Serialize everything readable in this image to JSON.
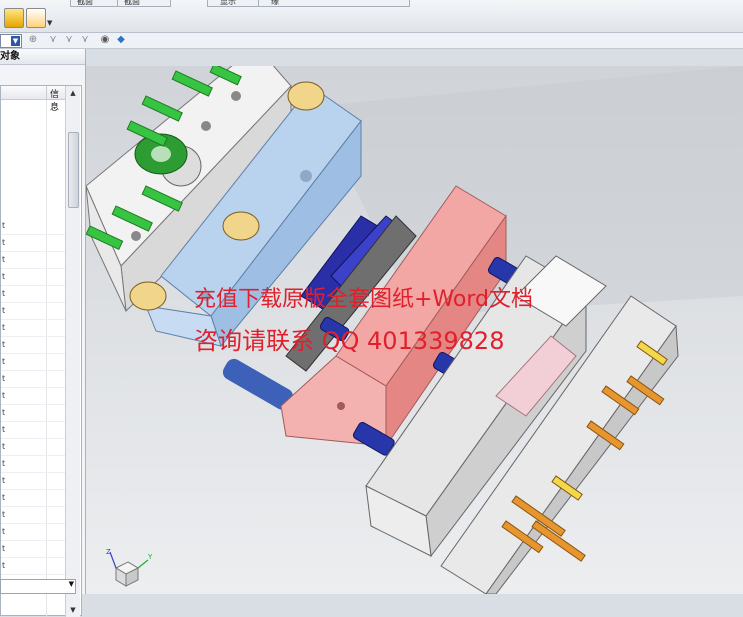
{
  "toolbar": {
    "icons": [
      "assembly-icon",
      "edit-icon"
    ],
    "dropdown_labels": [
      "截面",
      "截面",
      "显示",
      "缘"
    ]
  },
  "toolbar2": {
    "icons": [
      "snap-icon",
      "filter-icon",
      "filter2-icon",
      "view-icon",
      "render-icon"
    ]
  },
  "panel": {
    "title": "对象",
    "col_info": "信息",
    "rows": [
      "t",
      "t",
      "t",
      "t",
      "t",
      "t",
      "t",
      "t",
      "t",
      "t",
      "t",
      "t",
      "t",
      "t",
      "t",
      "t",
      "t",
      "t",
      "t",
      "t",
      "t",
      "t"
    ]
  },
  "watermark": {
    "line1": "充值下载原版全套图纸+Word文档",
    "line2": "咨询请联系 QQ 401339828"
  },
  "triad": {
    "z": "Z",
    "y": "Y",
    "x": "X"
  },
  "colors": {
    "plate_blue": "#b9d3ee",
    "plate_red": "#f2a7a5",
    "plate_gray": "#e6e6e6",
    "spring": "#2736a8",
    "pin_green": "#38c443",
    "pin_orange": "#e7962f",
    "watermark": "#e0202c"
  }
}
